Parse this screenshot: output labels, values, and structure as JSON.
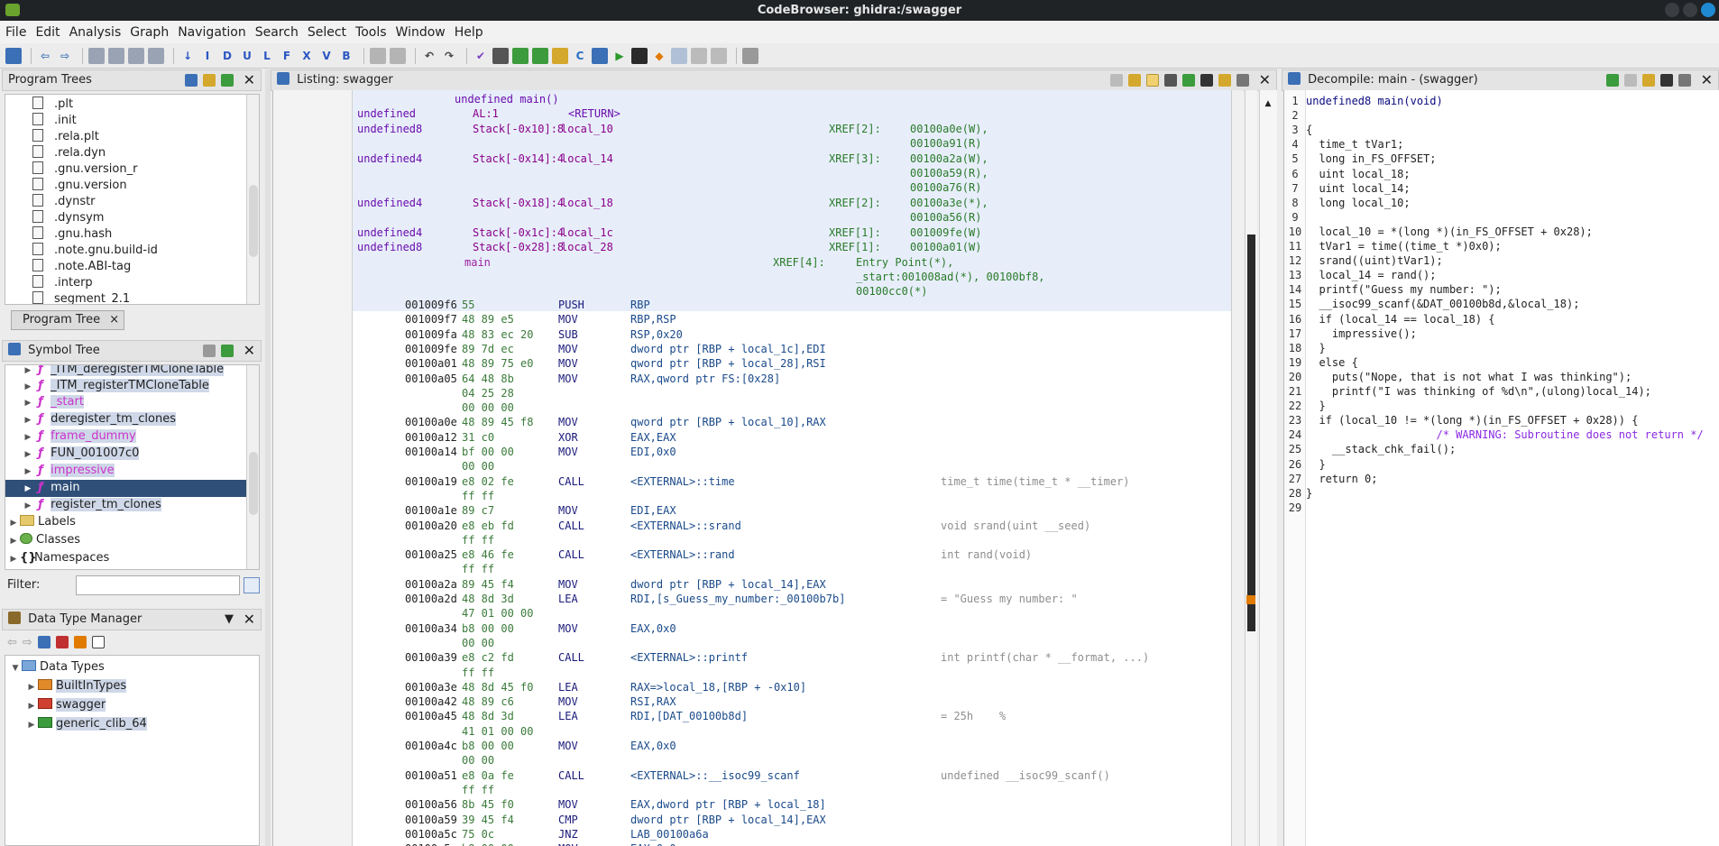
{
  "window": {
    "title": "CodeBrowser: ghidra:/swagger"
  },
  "menu": [
    "File",
    "Edit",
    "Analysis",
    "Graph",
    "Navigation",
    "Search",
    "Select",
    "Tools",
    "Window",
    "Help"
  ],
  "program_trees": {
    "title": "Program Trees",
    "items": [
      ".plt",
      ".init",
      ".rela.plt",
      ".rela.dyn",
      ".gnu.version_r",
      ".gnu.version",
      ".dynstr",
      ".dynsym",
      ".gnu.hash",
      ".note.gnu.build-id",
      ".note.ABI-tag",
      ".interp",
      "segment_2.1"
    ],
    "tab": "Program Tree"
  },
  "symbol_tree": {
    "title": "Symbol Tree",
    "functions": [
      "_ITM_deregisterTMCloneTable",
      "_ITM_registerTMCloneTable",
      "_start",
      "deregister_tm_clones",
      "frame_dummy",
      "FUN_001007c0",
      "impressive",
      "main",
      "register_tm_clones"
    ],
    "folders": [
      "Labels",
      "Classes",
      "Namespaces"
    ],
    "filter_label": "Filter:"
  },
  "data_type_manager": {
    "title": "Data Type Manager",
    "root": "Data Types",
    "items": [
      "BuiltInTypes",
      "swagger",
      "generic_clib_64"
    ]
  },
  "listing": {
    "title": "Listing:  swagger",
    "header": [
      {
        "a": "",
        "b": "",
        "c": "undefined main()",
        "d": "",
        "e": ""
      },
      {
        "a": "undefined",
        "b": "AL:1",
        "c": "<RETURN>",
        "d": "",
        "e": ""
      },
      {
        "a": "undefined8",
        "b": "Stack[-0x10]:8",
        "c": "local_10",
        "d": "XREF[2]:",
        "e": "00100a0e(W),"
      },
      {
        "a": "",
        "b": "",
        "c": "",
        "d": "",
        "e": "00100a91(R)"
      },
      {
        "a": "undefined4",
        "b": "Stack[-0x14]:4",
        "c": "local_14",
        "d": "XREF[3]:",
        "e": "00100a2a(W),"
      },
      {
        "a": "",
        "b": "",
        "c": "",
        "d": "",
        "e": "00100a59(R),"
      },
      {
        "a": "",
        "b": "",
        "c": "",
        "d": "",
        "e": "00100a76(R)"
      },
      {
        "a": "undefined4",
        "b": "Stack[-0x18]:4",
        "c": "local_18",
        "d": "XREF[2]:",
        "e": "00100a3e(*),"
      },
      {
        "a": "",
        "b": "",
        "c": "",
        "d": "",
        "e": "00100a56(R)"
      },
      {
        "a": "undefined4",
        "b": "Stack[-0x1c]:4",
        "c": "local_1c",
        "d": "XREF[1]:",
        "e": "001009fe(W)"
      },
      {
        "a": "undefined8",
        "b": "Stack[-0x28]:8",
        "c": "local_28",
        "d": "XREF[1]:",
        "e": "00100a01(W)"
      }
    ],
    "main_label": "main",
    "main_xref": "XREF[4]:",
    "main_xref_lines": [
      "Entry Point(*),",
      "_start:001008ad(*), 00100bf8,",
      "00100cc0(*)"
    ],
    "rows": [
      {
        "addr": "001009f6",
        "bytes": "55",
        "mn": "PUSH",
        "op": "RBP",
        "cm": ""
      },
      {
        "addr": "001009f7",
        "bytes": "48 89 e5",
        "mn": "MOV",
        "op": "RBP,RSP",
        "cm": ""
      },
      {
        "addr": "001009fa",
        "bytes": "48 83 ec 20",
        "mn": "SUB",
        "op": "RSP,0x20",
        "cm": ""
      },
      {
        "addr": "001009fe",
        "bytes": "89 7d ec",
        "mn": "MOV",
        "op": "dword ptr [RBP + local_1c],EDI",
        "cm": ""
      },
      {
        "addr": "00100a01",
        "bytes": "48 89 75 e0",
        "mn": "MOV",
        "op": "qword ptr [RBP + local_28],RSI",
        "cm": ""
      },
      {
        "addr": "00100a05",
        "bytes": "64 48 8b",
        "mn": "MOV",
        "op": "RAX,qword ptr FS:[0x28]",
        "cm": ""
      },
      {
        "addr": "",
        "bytes": "04 25 28",
        "mn": "",
        "op": "",
        "cm": ""
      },
      {
        "addr": "",
        "bytes": "00 00 00",
        "mn": "",
        "op": "",
        "cm": ""
      },
      {
        "addr": "00100a0e",
        "bytes": "48 89 45 f8",
        "mn": "MOV",
        "op": "qword ptr [RBP + local_10],RAX",
        "cm": ""
      },
      {
        "addr": "00100a12",
        "bytes": "31 c0",
        "mn": "XOR",
        "op": "EAX,EAX",
        "cm": ""
      },
      {
        "addr": "00100a14",
        "bytes": "bf 00 00",
        "mn": "MOV",
        "op": "EDI,0x0",
        "cm": ""
      },
      {
        "addr": "",
        "bytes": "00 00",
        "mn": "",
        "op": "",
        "cm": ""
      },
      {
        "addr": "00100a19",
        "bytes": "e8 02 fe",
        "mn": "CALL",
        "op": "<EXTERNAL>::time",
        "cm": "time_t time(time_t * __timer)"
      },
      {
        "addr": "",
        "bytes": "ff ff",
        "mn": "",
        "op": "",
        "cm": ""
      },
      {
        "addr": "00100a1e",
        "bytes": "89 c7",
        "mn": "MOV",
        "op": "EDI,EAX",
        "cm": ""
      },
      {
        "addr": "00100a20",
        "bytes": "e8 eb fd",
        "mn": "CALL",
        "op": "<EXTERNAL>::srand",
        "cm": "void srand(uint __seed)"
      },
      {
        "addr": "",
        "bytes": "ff ff",
        "mn": "",
        "op": "",
        "cm": ""
      },
      {
        "addr": "00100a25",
        "bytes": "e8 46 fe",
        "mn": "CALL",
        "op": "<EXTERNAL>::rand",
        "cm": "int rand(void)"
      },
      {
        "addr": "",
        "bytes": "ff ff",
        "mn": "",
        "op": "",
        "cm": ""
      },
      {
        "addr": "00100a2a",
        "bytes": "89 45 f4",
        "mn": "MOV",
        "op": "dword ptr [RBP + local_14],EAX",
        "cm": ""
      },
      {
        "addr": "00100a2d",
        "bytes": "48 8d 3d",
        "mn": "LEA",
        "op": "RDI,[s_Guess_my_number:_00100b7b]",
        "cm": "= \"Guess my number: \""
      },
      {
        "addr": "",
        "bytes": "47 01 00 00",
        "mn": "",
        "op": "",
        "cm": ""
      },
      {
        "addr": "00100a34",
        "bytes": "b8 00 00",
        "mn": "MOV",
        "op": "EAX,0x0",
        "cm": ""
      },
      {
        "addr": "",
        "bytes": "00 00",
        "mn": "",
        "op": "",
        "cm": ""
      },
      {
        "addr": "00100a39",
        "bytes": "e8 c2 fd",
        "mn": "CALL",
        "op": "<EXTERNAL>::printf",
        "cm": "int printf(char * __format, ...)"
      },
      {
        "addr": "",
        "bytes": "ff ff",
        "mn": "",
        "op": "",
        "cm": ""
      },
      {
        "addr": "00100a3e",
        "bytes": "48 8d 45 f0",
        "mn": "LEA",
        "op": "RAX=>local_18,[RBP + -0x10]",
        "cm": ""
      },
      {
        "addr": "00100a42",
        "bytes": "48 89 c6",
        "mn": "MOV",
        "op": "RSI,RAX",
        "cm": ""
      },
      {
        "addr": "00100a45",
        "bytes": "48 8d 3d",
        "mn": "LEA",
        "op": "RDI,[DAT_00100b8d]",
        "cm": "= 25h    %"
      },
      {
        "addr": "",
        "bytes": "41 01 00 00",
        "mn": "",
        "op": "",
        "cm": ""
      },
      {
        "addr": "00100a4c",
        "bytes": "b8 00 00",
        "mn": "MOV",
        "op": "EAX,0x0",
        "cm": ""
      },
      {
        "addr": "",
        "bytes": "00 00",
        "mn": "",
        "op": "",
        "cm": ""
      },
      {
        "addr": "00100a51",
        "bytes": "e8 0a fe",
        "mn": "CALL",
        "op": "<EXTERNAL>::__isoc99_scanf",
        "cm": "undefined __isoc99_scanf()"
      },
      {
        "addr": "",
        "bytes": "ff ff",
        "mn": "",
        "op": "",
        "cm": ""
      },
      {
        "addr": "00100a56",
        "bytes": "8b 45 f0",
        "mn": "MOV",
        "op": "EAX,dword ptr [RBP + local_18]",
        "cm": ""
      },
      {
        "addr": "00100a59",
        "bytes": "39 45 f4",
        "mn": "CMP",
        "op": "dword ptr [RBP + local_14],EAX",
        "cm": ""
      },
      {
        "addr": "00100a5c",
        "bytes": "75 0c",
        "mn": "JNZ",
        "op": "LAB_00100a6a",
        "cm": ""
      },
      {
        "addr": "00100a5e",
        "bytes": "b8 00 00",
        "mn": "MOV",
        "op": "EAX,0x0",
        "cm": ""
      }
    ]
  },
  "decompile": {
    "title": "Decompile: main -  (swagger)",
    "lines": [
      "undefined8 main(void)",
      "",
      "{",
      "  time_t tVar1;",
      "  long in_FS_OFFSET;",
      "  uint local_18;",
      "  uint local_14;",
      "  long local_10;",
      "",
      "  local_10 = *(long *)(in_FS_OFFSET + 0x28);",
      "  tVar1 = time((time_t *)0x0);",
      "  srand((uint)tVar1);",
      "  local_14 = rand();",
      "  printf(\"Guess my number: \");",
      "  __isoc99_scanf(&DAT_00100b8d,&local_18);",
      "  if (local_14 == local_18) {",
      "    impressive();",
      "  }",
      "  else {",
      "    puts(\"Nope, that is not what I was thinking\");",
      "    printf(\"I was thinking of %d\\n\",(ulong)local_14);",
      "  }",
      "  if (local_10 != *(long *)(in_FS_OFFSET + 0x28)) {",
      "                    /* WARNING: Subroutine does not return */",
      "    __stack_chk_fail();",
      "  }",
      "  return 0;",
      "}",
      ""
    ]
  }
}
